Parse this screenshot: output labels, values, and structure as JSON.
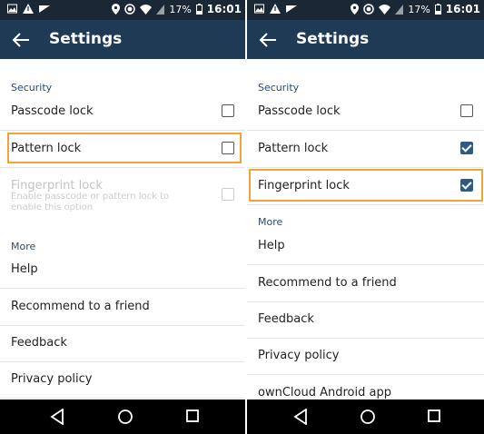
{
  "left": {
    "status": {
      "battery": "17%",
      "time": "16:01"
    },
    "app_title": "Settings",
    "sections": [
      {
        "label": "Security"
      },
      {
        "label": "More"
      }
    ],
    "rows": [
      {
        "label": "Passcode lock",
        "checked": false
      },
      {
        "label": "Pattern lock",
        "checked": false
      },
      {
        "label": "Fingerprint lock",
        "disabled": true,
        "subtitle": "Enable passcode or pattern lock to enable this option",
        "checked": false
      },
      {
        "label": "Help"
      },
      {
        "label": "Recommend to a friend"
      },
      {
        "label": "Feedback"
      },
      {
        "label": "Privacy policy"
      }
    ]
  },
  "right": {
    "status": {
      "battery": "17%",
      "time": "16:01"
    },
    "app_title": "Settings",
    "sections": [
      {
        "label": "Security"
      },
      {
        "label": "More"
      }
    ],
    "rows": [
      {
        "label": "Passcode lock",
        "checked": false
      },
      {
        "label": "Pattern lock",
        "checked": true
      },
      {
        "label": "Fingerprint lock",
        "checked": true
      },
      {
        "label": "Help"
      },
      {
        "label": "Recommend to a friend"
      },
      {
        "label": "Feedback"
      },
      {
        "label": "Privacy policy"
      },
      {
        "label": "ownCloud Android app"
      }
    ]
  },
  "icons": {
    "statusbar_left": [
      "image-icon",
      "alert-icon",
      "cast-icon"
    ],
    "statusbar_right": [
      "location-icon",
      "target-icon",
      "wifi-icon",
      "signal-icon",
      "battery-icon"
    ],
    "appbar": "back-arrow-icon",
    "navbar": [
      "back-triangle-icon",
      "home-circle-icon",
      "recents-square-icon"
    ]
  },
  "colors": {
    "statusbar": "#1a2836",
    "appbar": "#1f3a55",
    "section_text": "#2a4a72",
    "checkbox_checked": "#2f5a86",
    "highlight": "#f0a43a"
  }
}
